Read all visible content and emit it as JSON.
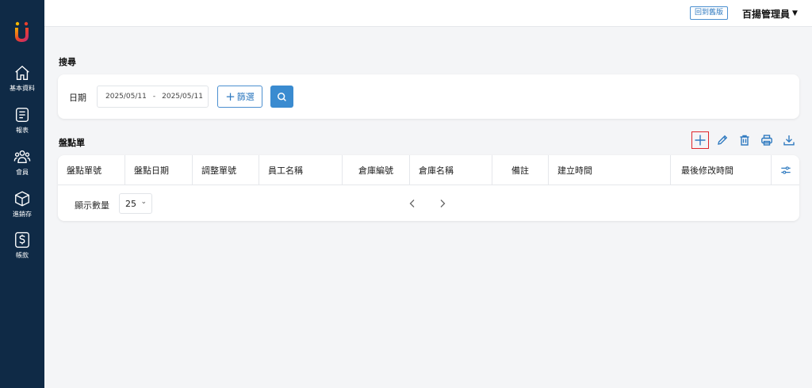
{
  "sidebar": {
    "items": [
      {
        "label": "基本資料",
        "icon": "home-icon"
      },
      {
        "label": "報表",
        "icon": "report-icon"
      },
      {
        "label": "會員",
        "icon": "members-icon"
      },
      {
        "label": "進銷存",
        "icon": "inventory-box-icon"
      },
      {
        "label": "帳款",
        "icon": "dollar-icon"
      }
    ]
  },
  "header": {
    "old_version_label": "回到舊版",
    "user_name": "百揚管理員"
  },
  "search": {
    "title": "搜尋",
    "date_label": "日期",
    "date_start": "2025/05/11",
    "date_separator": "-",
    "date_end": "2025/05/11",
    "filter_label": "篩選"
  },
  "table": {
    "title": "盤點單",
    "columns": [
      "盤點單號",
      "盤點日期",
      "調整單號",
      "員工名稱",
      "倉庫編號",
      "倉庫名稱",
      "備註",
      "建立時間",
      "最後修改時間"
    ],
    "page_size_label": "顯示數量",
    "page_size_value": "25"
  },
  "colors": {
    "sidebar_bg": "#0f2a46",
    "accent": "#3a8bd0",
    "active_outline": "#e0262b"
  }
}
